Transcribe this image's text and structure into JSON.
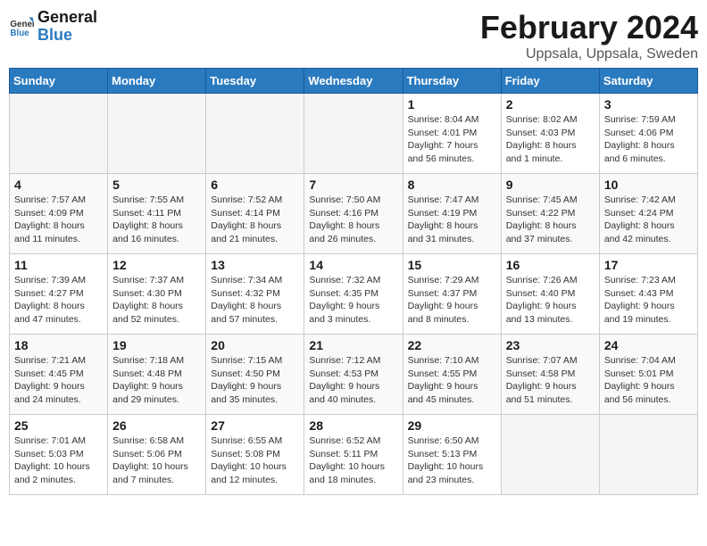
{
  "header": {
    "logo_line1": "General",
    "logo_line2": "Blue",
    "title": "February 2024",
    "subtitle": "Uppsala, Uppsala, Sweden"
  },
  "days_of_week": [
    "Sunday",
    "Monday",
    "Tuesday",
    "Wednesday",
    "Thursday",
    "Friday",
    "Saturday"
  ],
  "weeks": [
    [
      {
        "day": "",
        "info": ""
      },
      {
        "day": "",
        "info": ""
      },
      {
        "day": "",
        "info": ""
      },
      {
        "day": "",
        "info": ""
      },
      {
        "day": "1",
        "info": "Sunrise: 8:04 AM\nSunset: 4:01 PM\nDaylight: 7 hours\nand 56 minutes."
      },
      {
        "day": "2",
        "info": "Sunrise: 8:02 AM\nSunset: 4:03 PM\nDaylight: 8 hours\nand 1 minute."
      },
      {
        "day": "3",
        "info": "Sunrise: 7:59 AM\nSunset: 4:06 PM\nDaylight: 8 hours\nand 6 minutes."
      }
    ],
    [
      {
        "day": "4",
        "info": "Sunrise: 7:57 AM\nSunset: 4:09 PM\nDaylight: 8 hours\nand 11 minutes."
      },
      {
        "day": "5",
        "info": "Sunrise: 7:55 AM\nSunset: 4:11 PM\nDaylight: 8 hours\nand 16 minutes."
      },
      {
        "day": "6",
        "info": "Sunrise: 7:52 AM\nSunset: 4:14 PM\nDaylight: 8 hours\nand 21 minutes."
      },
      {
        "day": "7",
        "info": "Sunrise: 7:50 AM\nSunset: 4:16 PM\nDaylight: 8 hours\nand 26 minutes."
      },
      {
        "day": "8",
        "info": "Sunrise: 7:47 AM\nSunset: 4:19 PM\nDaylight: 8 hours\nand 31 minutes."
      },
      {
        "day": "9",
        "info": "Sunrise: 7:45 AM\nSunset: 4:22 PM\nDaylight: 8 hours\nand 37 minutes."
      },
      {
        "day": "10",
        "info": "Sunrise: 7:42 AM\nSunset: 4:24 PM\nDaylight: 8 hours\nand 42 minutes."
      }
    ],
    [
      {
        "day": "11",
        "info": "Sunrise: 7:39 AM\nSunset: 4:27 PM\nDaylight: 8 hours\nand 47 minutes."
      },
      {
        "day": "12",
        "info": "Sunrise: 7:37 AM\nSunset: 4:30 PM\nDaylight: 8 hours\nand 52 minutes."
      },
      {
        "day": "13",
        "info": "Sunrise: 7:34 AM\nSunset: 4:32 PM\nDaylight: 8 hours\nand 57 minutes."
      },
      {
        "day": "14",
        "info": "Sunrise: 7:32 AM\nSunset: 4:35 PM\nDaylight: 9 hours\nand 3 minutes."
      },
      {
        "day": "15",
        "info": "Sunrise: 7:29 AM\nSunset: 4:37 PM\nDaylight: 9 hours\nand 8 minutes."
      },
      {
        "day": "16",
        "info": "Sunrise: 7:26 AM\nSunset: 4:40 PM\nDaylight: 9 hours\nand 13 minutes."
      },
      {
        "day": "17",
        "info": "Sunrise: 7:23 AM\nSunset: 4:43 PM\nDaylight: 9 hours\nand 19 minutes."
      }
    ],
    [
      {
        "day": "18",
        "info": "Sunrise: 7:21 AM\nSunset: 4:45 PM\nDaylight: 9 hours\nand 24 minutes."
      },
      {
        "day": "19",
        "info": "Sunrise: 7:18 AM\nSunset: 4:48 PM\nDaylight: 9 hours\nand 29 minutes."
      },
      {
        "day": "20",
        "info": "Sunrise: 7:15 AM\nSunset: 4:50 PM\nDaylight: 9 hours\nand 35 minutes."
      },
      {
        "day": "21",
        "info": "Sunrise: 7:12 AM\nSunset: 4:53 PM\nDaylight: 9 hours\nand 40 minutes."
      },
      {
        "day": "22",
        "info": "Sunrise: 7:10 AM\nSunset: 4:55 PM\nDaylight: 9 hours\nand 45 minutes."
      },
      {
        "day": "23",
        "info": "Sunrise: 7:07 AM\nSunset: 4:58 PM\nDaylight: 9 hours\nand 51 minutes."
      },
      {
        "day": "24",
        "info": "Sunrise: 7:04 AM\nSunset: 5:01 PM\nDaylight: 9 hours\nand 56 minutes."
      }
    ],
    [
      {
        "day": "25",
        "info": "Sunrise: 7:01 AM\nSunset: 5:03 PM\nDaylight: 10 hours\nand 2 minutes."
      },
      {
        "day": "26",
        "info": "Sunrise: 6:58 AM\nSunset: 5:06 PM\nDaylight: 10 hours\nand 7 minutes."
      },
      {
        "day": "27",
        "info": "Sunrise: 6:55 AM\nSunset: 5:08 PM\nDaylight: 10 hours\nand 12 minutes."
      },
      {
        "day": "28",
        "info": "Sunrise: 6:52 AM\nSunset: 5:11 PM\nDaylight: 10 hours\nand 18 minutes."
      },
      {
        "day": "29",
        "info": "Sunrise: 6:50 AM\nSunset: 5:13 PM\nDaylight: 10 hours\nand 23 minutes."
      },
      {
        "day": "",
        "info": ""
      },
      {
        "day": "",
        "info": ""
      }
    ]
  ]
}
